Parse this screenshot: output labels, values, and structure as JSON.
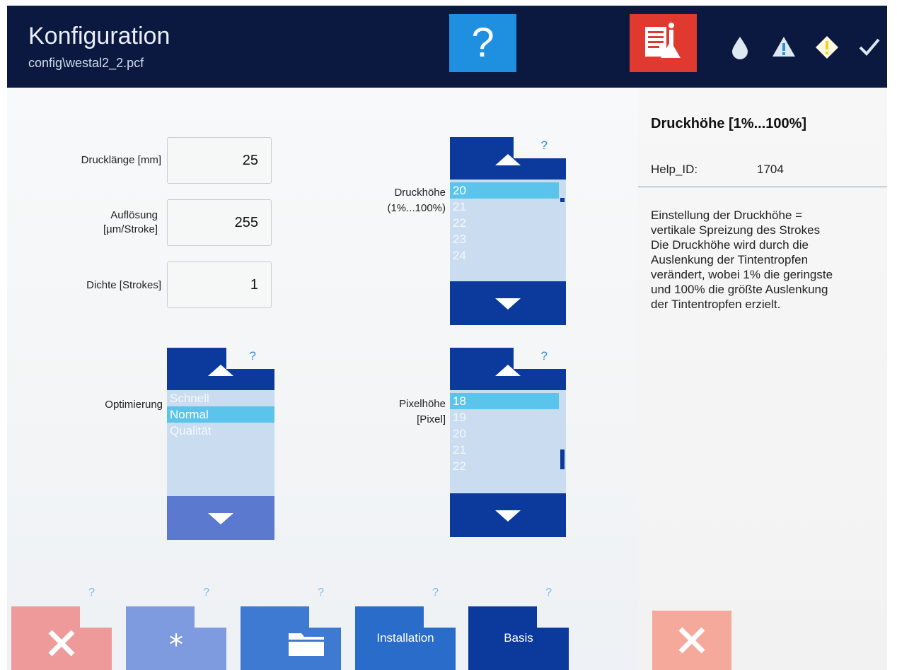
{
  "header": {
    "title": "Konfiguration",
    "subtitle": "config\\westal2_2.pcf",
    "help_button": "?",
    "status_colors": [
      "#2a8fd8",
      "#2a8fd8",
      "#f2d21b",
      "#2a8fd8"
    ]
  },
  "fields": [
    {
      "label": "Drucklänge [mm]",
      "value": "25"
    },
    {
      "label": "Auflösung\n[µm/Stroke]",
      "value": "255"
    },
    {
      "label": "Dichte [Strokes]",
      "value": "1"
    }
  ],
  "optimierung": {
    "label": "Optimierung",
    "help": "?",
    "items": [
      "Schnell",
      "Normal",
      "Qualität"
    ],
    "selected_index": 1
  },
  "druckhoehe": {
    "label": "Druckhöhe",
    "sublabel": "(1%...100%)",
    "help": "?",
    "items": [
      "20",
      "21",
      "22",
      "23",
      "24"
    ],
    "selected_index": 0
  },
  "pixelhoehe": {
    "label": "Pixelhöhe",
    "sublabel": "[Pixel]",
    "help": "?",
    "items": [
      "18",
      "19",
      "20",
      "21",
      "22"
    ],
    "selected_index": 0
  },
  "help_panel": {
    "title": "Druckhöhe [1%...100%]",
    "id_label": "Help_ID:",
    "id_value": "1704",
    "lines": [
      "Einstellung der Druckhöhe =",
      "vertikale Spreizung des Strokes",
      "Die Druckhöhe wird durch die",
      "Auslenkung der Tintentropfen",
      "verändert, wobei 1% die geringste",
      "und 100% die größte Auslenkung",
      "der Tintentropfen erzielt."
    ]
  },
  "bottom_buttons": {
    "cancel_help": "?",
    "new_help": "?",
    "open_help": "?",
    "installation_label": "Installation",
    "installation_help": "?",
    "basis_label": "Basis",
    "basis_help": "?"
  },
  "colors": {
    "navy": "#0b1840",
    "accent_blue": "#0b3a9c",
    "help_blue": "#1f8fe0",
    "info_red": "#e0392f",
    "selection": "#5bc4ec",
    "cancel_red": "#ef9a9a"
  }
}
